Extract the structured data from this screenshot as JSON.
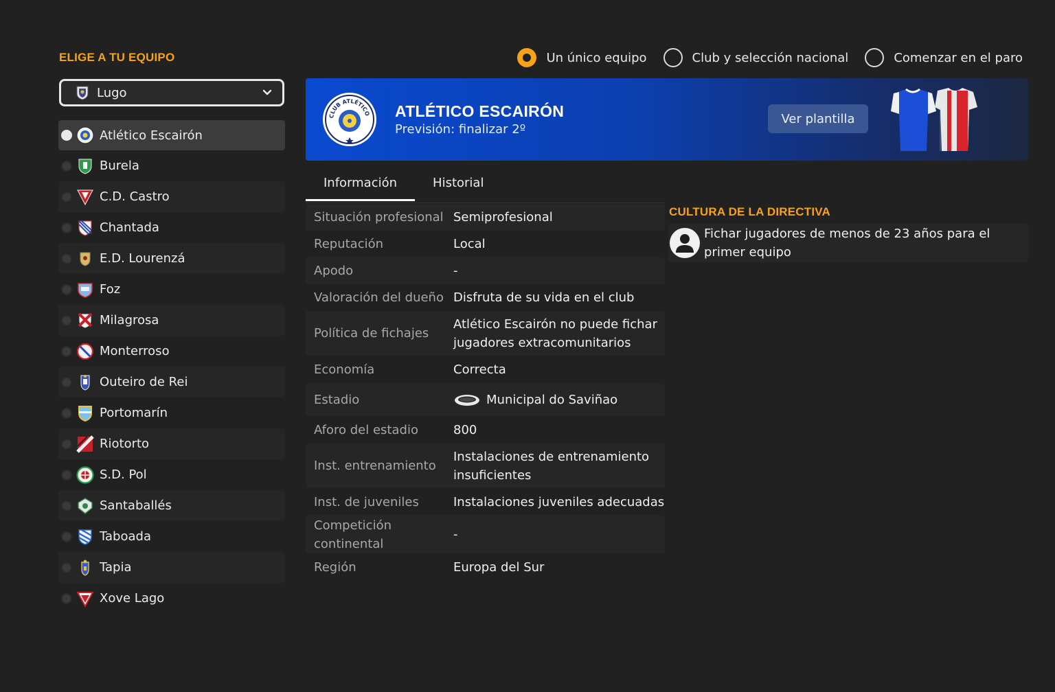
{
  "header": {
    "pick_team_title": "ELIGE A TU EQUIPO"
  },
  "modes": [
    {
      "label": "Un único equipo",
      "selected": true
    },
    {
      "label": "Club y selección nacional",
      "selected": false
    },
    {
      "label": "Comenzar en el paro",
      "selected": false
    }
  ],
  "league_select": {
    "value": "Lugo"
  },
  "teams": [
    {
      "name": "Atlético Escairón",
      "selected": true
    },
    {
      "name": "Burela"
    },
    {
      "name": "C.D. Castro"
    },
    {
      "name": "Chantada"
    },
    {
      "name": "E.D. Lourenzá"
    },
    {
      "name": "Foz"
    },
    {
      "name": "Milagrosa"
    },
    {
      "name": "Monterroso"
    },
    {
      "name": "Outeiro de Rei"
    },
    {
      "name": "Portomarín"
    },
    {
      "name": "Riotorto"
    },
    {
      "name": "S.D. Pol"
    },
    {
      "name": "Santaballés"
    },
    {
      "name": "Taboada"
    },
    {
      "name": "Tapia"
    },
    {
      "name": "Xove Lago"
    }
  ],
  "banner": {
    "club_name": "ATLÉTICO ESCAIRÓN",
    "forecast": "Previsión: finalizar 2º",
    "squad_button": "Ver plantilla",
    "logo_text": "CLUB ATLÉTICO ESCAIRÓN",
    "color_primary": "#0a4ad0"
  },
  "tabs": [
    {
      "label": "Información",
      "active": true
    },
    {
      "label": "Historial",
      "active": false
    }
  ],
  "info": {
    "rows": [
      {
        "k": "Situación profesional",
        "v": "Semiprofesional"
      },
      {
        "k": "Reputación",
        "v": "Local"
      },
      {
        "k": "Apodo",
        "v": "-"
      },
      {
        "k": "Valoración del dueño",
        "v": "Disfruta de su vida en el club"
      },
      {
        "k": "Política de fichajes",
        "v": "Atlético Escairón no puede fichar jugadores extracomunitarios"
      },
      {
        "k": "Economía",
        "v": "Correcta"
      },
      {
        "k": "Estadio",
        "v": "Municipal do Saviñao"
      },
      {
        "k": "Aforo del estadio",
        "v": "800"
      },
      {
        "k": "Inst. entrenamiento",
        "v": "Instalaciones de entrenamiento insuficientes"
      },
      {
        "k": "Inst. de juveniles",
        "v": "Instalaciones juveniles adecuadas"
      },
      {
        "k": "Competición continental",
        "v": "-"
      },
      {
        "k": "Región",
        "v": "Europa del Sur"
      }
    ]
  },
  "board": {
    "title": "CULTURA DE LA DIRECTIVA",
    "items": [
      "Fichar jugadores de menos de 23 años para el primer equipo"
    ]
  },
  "colors": {
    "accent": "#f7a21b",
    "background": "#212121"
  }
}
